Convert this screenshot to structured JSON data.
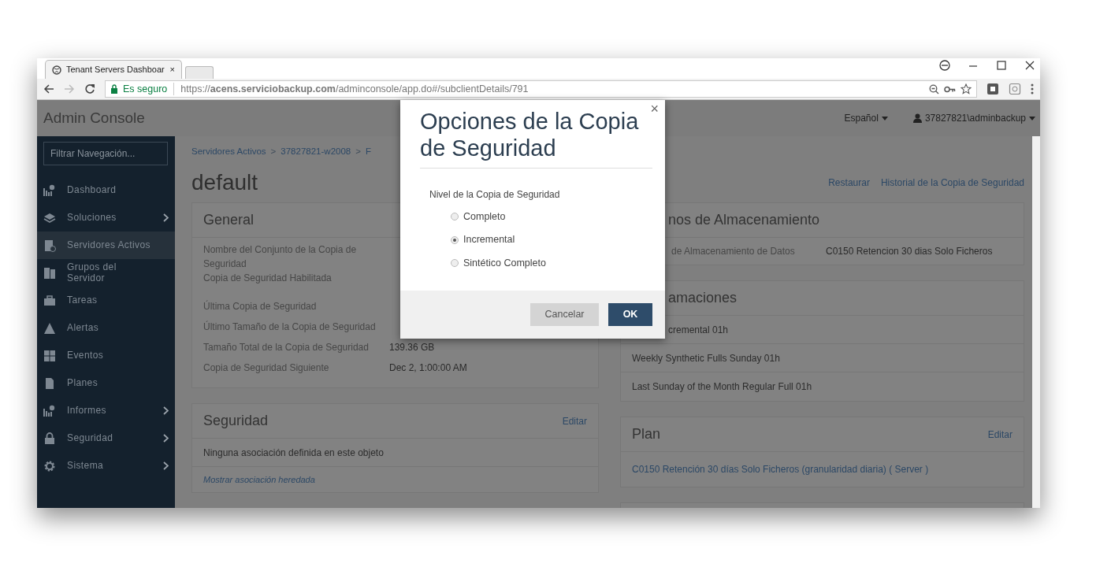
{
  "browser": {
    "tab_title": "Tenant Servers Dashboar",
    "tab_close": "×",
    "secure_label": "Es seguro",
    "url": "https://**acens.serviciobackup.com**/adminconsole/app.do#/subclientDetails/791"
  },
  "app": {
    "title": "Admin Console",
    "language": "Español",
    "user": "37827821\\adminbackup"
  },
  "sidebar": {
    "filter_placeholder": "Filtrar Navegación...",
    "items": [
      {
        "label": "Dashboard",
        "has_submenu": false,
        "selected": false
      },
      {
        "label": "Soluciones",
        "has_submenu": true,
        "selected": false
      },
      {
        "label": "Servidores Activos",
        "has_submenu": false,
        "selected": true
      },
      {
        "label": "Grupos del Servidor",
        "has_submenu": false,
        "selected": false
      },
      {
        "label": "Tareas",
        "has_submenu": false,
        "selected": false
      },
      {
        "label": "Alertas",
        "has_submenu": false,
        "selected": false
      },
      {
        "label": "Eventos",
        "has_submenu": false,
        "selected": false
      },
      {
        "label": "Planes",
        "has_submenu": false,
        "selected": false
      },
      {
        "label": "Informes",
        "has_submenu": true,
        "selected": false
      },
      {
        "label": "Seguridad",
        "has_submenu": true,
        "selected": false
      },
      {
        "label": "Sistema",
        "has_submenu": true,
        "selected": false
      }
    ]
  },
  "breadcrumb": [
    {
      "label": "Servidores Activos",
      "separator": ">"
    },
    {
      "label": "37827821-w2008",
      "separator": ">"
    },
    {
      "label": "F"
    }
  ],
  "page_title": "default",
  "actions": [
    "Restaurar",
    "Historial de la Copia de Seguridad"
  ],
  "general": {
    "title": "General",
    "rows": [
      {
        "label": "Nombre del Conjunto de la Copia de Seguridad"
      },
      {
        "label": "Copia de Seguridad Habilitada"
      },
      {
        "label": "Última Copia de Seguridad"
      },
      {
        "label": "Último Tamaño de la Copia de Seguridad"
      },
      {
        "label": "Tamaño Total de la Copia de Seguridad",
        "value": "139.36 GB"
      },
      {
        "label": "Copia de Seguridad Siguiente",
        "value": "Dec 2, 1:00:00 AM"
      }
    ]
  },
  "security": {
    "title": "Seguridad",
    "edit": "Editar",
    "message": "Ninguna asociación definida en este objeto",
    "link": "Mostrar asociación heredada"
  },
  "storage": {
    "title": "nos de Almacenamiento",
    "rows": [
      {
        "label": "de Almacenamiento de Datos",
        "value": "C0150 Retencion 30 dias Solo Ficheros"
      }
    ]
  },
  "schedules": {
    "title": "amaciones",
    "items": [
      "cremental 01h",
      "Weekly Synthetic Fulls Sunday 01h",
      "Last Sunday of the Month Regular Full 01h"
    ]
  },
  "plan": {
    "title": "Plan",
    "edit": "Editar",
    "link": "C0150 Retención 30 días Solo Ficheros (granularidad diaria) ( Server )"
  },
  "modal": {
    "title": "Opciones de la Copia de Seguridad",
    "close": "×",
    "field_label": "Nivel de la Copia de Seguridad",
    "options": [
      {
        "label": "Completo",
        "selected": false
      },
      {
        "label": "Incremental",
        "selected": true
      },
      {
        "label": "Sintético Completo",
        "selected": false
      }
    ],
    "cancel": "Cancelar",
    "ok": "OK"
  }
}
